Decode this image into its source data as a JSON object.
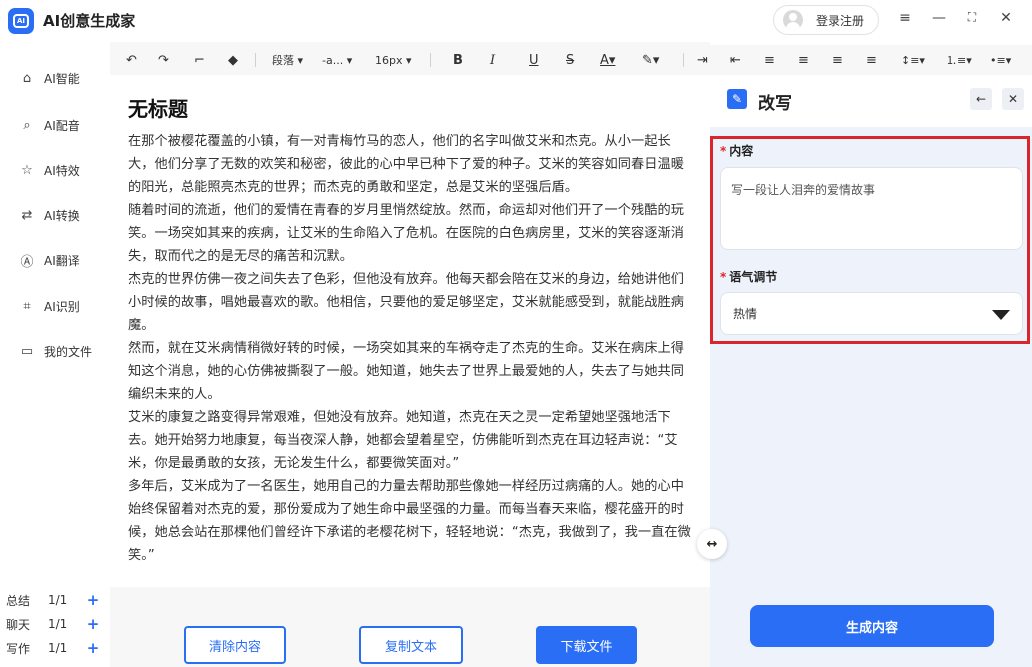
{
  "app": {
    "title": "AI创意生成家",
    "logo_text": "AI",
    "login_label": "登录注册",
    "win_menu": "≡",
    "win_min": "—",
    "win_max": "⛶",
    "win_close": "✕"
  },
  "sidebar": {
    "items": [
      {
        "label": "AI智能",
        "icon": "robot-icon",
        "glyph": "⌂"
      },
      {
        "label": "AI配音",
        "icon": "microphone-icon",
        "glyph": "⌕"
      },
      {
        "label": "AI特效",
        "icon": "star-icon",
        "glyph": "☆"
      },
      {
        "label": "AI转换",
        "icon": "convert-icon",
        "glyph": "⇄"
      },
      {
        "label": "AI翻译",
        "icon": "translate-icon",
        "glyph": "Ⓐ"
      },
      {
        "label": "AI识别",
        "icon": "scan-icon",
        "glyph": "⌗"
      },
      {
        "label": "我的文件",
        "icon": "folder-icon",
        "glyph": "▭"
      }
    ],
    "counters": [
      {
        "label": "总结",
        "value": "1/1"
      },
      {
        "label": "聊天",
        "value": "1/1"
      },
      {
        "label": "写作",
        "value": "1/1"
      }
    ]
  },
  "toolbar": {
    "paragraph": "段落 ▾",
    "font": "-a... ▾",
    "size": "16px ▾"
  },
  "document": {
    "title": "无标题",
    "paragraphs": [
      "在那个被樱花覆盖的小镇，有一对青梅竹马的恋人，他们的名字叫做艾米和杰克。从小一起长大，他们分享了无数的欢笑和秘密，彼此的心中早已种下了爱的种子。艾米的笑容如同春日温暖的阳光，总能照亮杰克的世界；而杰克的勇敢和坚定，总是艾米的坚强后盾。",
      "随着时间的流逝，他们的爱情在青春的岁月里悄然绽放。然而，命运却对他们开了一个残酷的玩笑。一场突如其来的疾病，让艾米的生命陷入了危机。在医院的白色病房里，艾米的笑容逐渐消失，取而代之的是无尽的痛苦和沉默。",
      "杰克的世界仿佛一夜之间失去了色彩，但他没有放弃。他每天都会陪在艾米的身边，给她讲他们小时候的故事，唱她最喜欢的歌。他相信，只要他的爱足够坚定，艾米就能感受到，就能战胜病魔。",
      "然而，就在艾米病情稍微好转的时候，一场突如其来的车祸夺走了杰克的生命。艾米在病床上得知这个消息，她的心仿佛被撕裂了一般。她知道，她失去了世界上最爱她的人，失去了与她共同编织未来的人。",
      "艾米的康复之路变得异常艰难，但她没有放弃。她知道，杰克在天之灵一定希望她坚强地活下去。她开始努力地康复，每当夜深人静，她都会望着星空，仿佛能听到杰克在耳边轻声说：“艾米，你是最勇敢的女孩，无论发生什么，都要微笑面对。”",
      "多年后，艾米成为了一名医生，她用自己的力量去帮助那些像她一样经历过病痛的人。她的心中始终保留着对杰克的爱，那份爱成为了她生命中最坚强的力量。而每当春天来临，樱花盛开的时候，她总会站在那棵他们曾经许下承诺的老樱花树下，轻轻地说：“杰克，我做到了，我一直在微笑。”"
    ]
  },
  "actions": {
    "clear": "清除内容",
    "copy": "复制文本",
    "download": "下载文件"
  },
  "panel": {
    "title": "改写",
    "back": "←",
    "close": "✕",
    "content_label": "内容",
    "content_value": "写一段让人泪奔的爱情故事",
    "tone_label": "语气调节",
    "tone_value": "热情",
    "generate": "生成内容",
    "required_mark": "*"
  },
  "colors": {
    "accent": "#2a6ef5",
    "highlight": "#d9262c",
    "panel_bg": "#eef3fb"
  }
}
